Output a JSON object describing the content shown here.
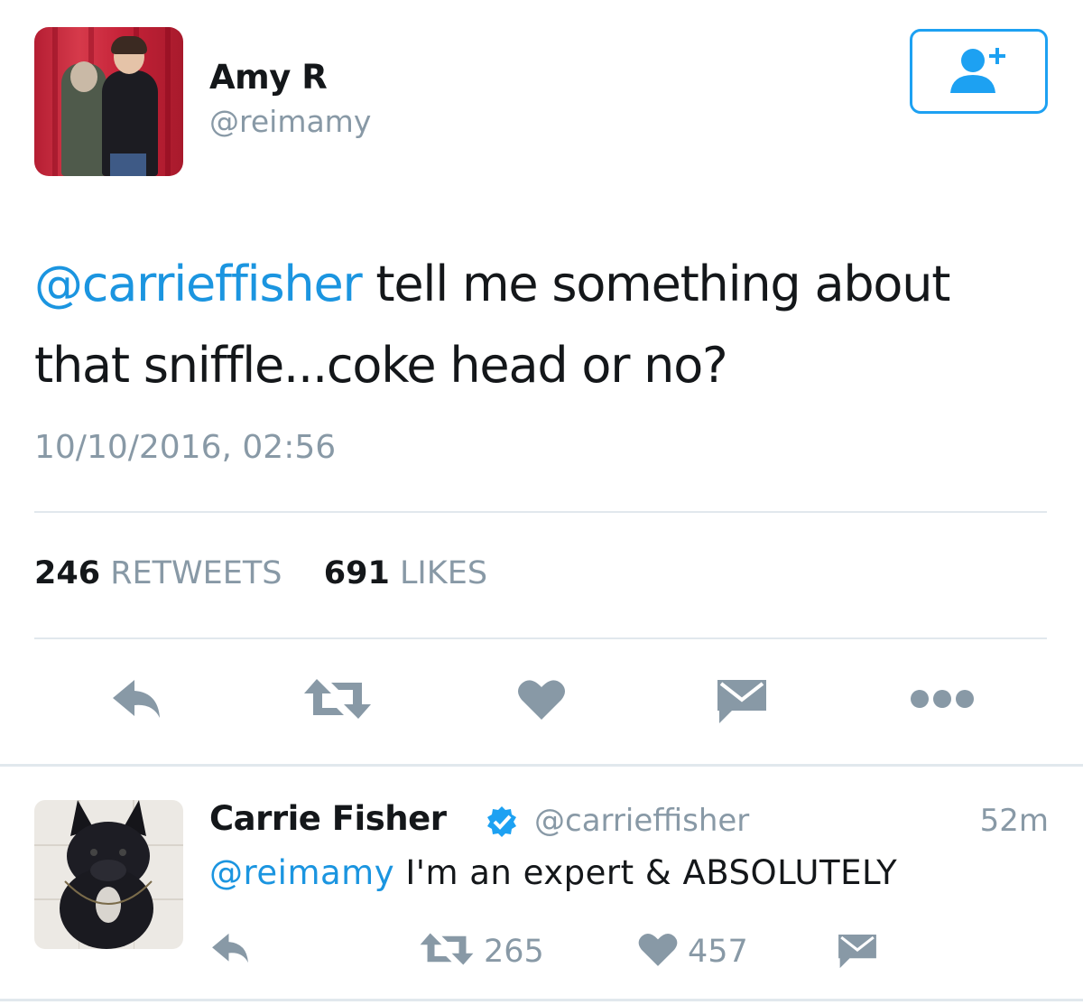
{
  "main_tweet": {
    "name": "Amy R",
    "handle": "@reimamy",
    "mention": "@carrieffisher",
    "text": " tell me something about that sniffle...coke head or no?",
    "timestamp": "10/10/2016, 02:56",
    "retweets_count": "246",
    "retweets_label": "RETWEETS",
    "likes_count": "691",
    "likes_label": "LIKES",
    "icons": {
      "follow": "add-user-icon",
      "reply": "reply-icon",
      "retweet": "retweet-icon",
      "like": "heart-icon",
      "message": "envelope-icon",
      "more": "more-dots-icon"
    }
  },
  "reply_tweet": {
    "name": "Carrie Fisher",
    "handle": "@carrieffisher",
    "time": "52m",
    "mention": "@reimamy",
    "text": " I'm an expert & ABSOLUTELY",
    "retweet_count": "265",
    "like_count": "457",
    "verified_icon": "verified-badge-icon"
  },
  "colors": {
    "accent": "#1da1f2",
    "link": "#1b95e0",
    "muted": "#8899a6",
    "icon": "#8899a6",
    "divider": "#e1e8ed",
    "text": "#14171a"
  }
}
